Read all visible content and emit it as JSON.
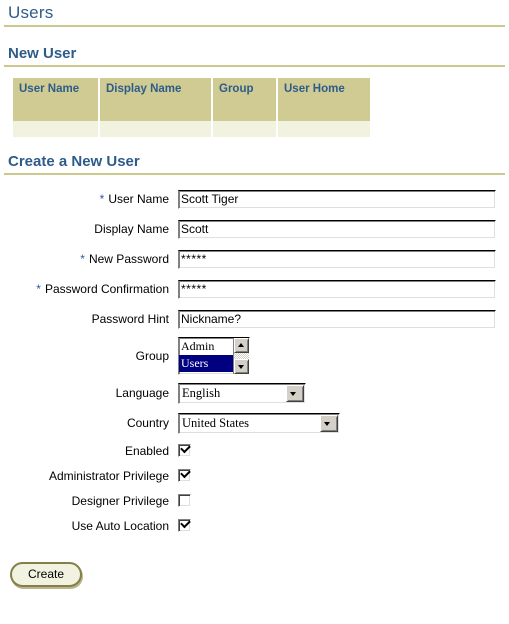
{
  "page": {
    "title": "Users",
    "accent_blue": "#2e5c8a",
    "rule_color": "#cdc98e",
    "header_bg": "#cfcb92",
    "cell_bg": "#f2f2e0",
    "select_highlight": "#000080"
  },
  "new_user_section": {
    "title": "New User",
    "table": {
      "columns": [
        "User Name",
        "Display Name",
        "Group",
        "User Home"
      ],
      "rows": [
        [
          "",
          "",
          "",
          ""
        ]
      ]
    }
  },
  "create_section": {
    "title": "Create a New User",
    "required_marker": "*",
    "fields": [
      {
        "label": "User Name",
        "required": true,
        "type": "text",
        "value": "Scott Tiger",
        "placeholder": ""
      },
      {
        "label": "Display Name",
        "required": false,
        "type": "text",
        "value": "Scott",
        "placeholder": ""
      },
      {
        "label": "New Password",
        "required": true,
        "type": "password",
        "value": "*****",
        "placeholder": ""
      },
      {
        "label": "Password Confirmation",
        "required": true,
        "type": "password",
        "value": "*****",
        "placeholder": ""
      },
      {
        "label": "Password Hint",
        "required": false,
        "type": "text",
        "value": "Nickname?",
        "placeholder": ""
      }
    ],
    "group": {
      "label": "Group",
      "options": [
        "Admin",
        "Users"
      ],
      "selected": "Users"
    },
    "language": {
      "label": "Language",
      "selected": "English"
    },
    "country": {
      "label": "Country",
      "selected": "United States"
    },
    "checkboxes": [
      {
        "label": "Enabled",
        "checked": true
      },
      {
        "label": "Administrator Privilege",
        "checked": true
      },
      {
        "label": "Designer Privilege",
        "checked": false
      },
      {
        "label": "Use Auto Location",
        "checked": true
      }
    ],
    "submit_label": "Create"
  }
}
